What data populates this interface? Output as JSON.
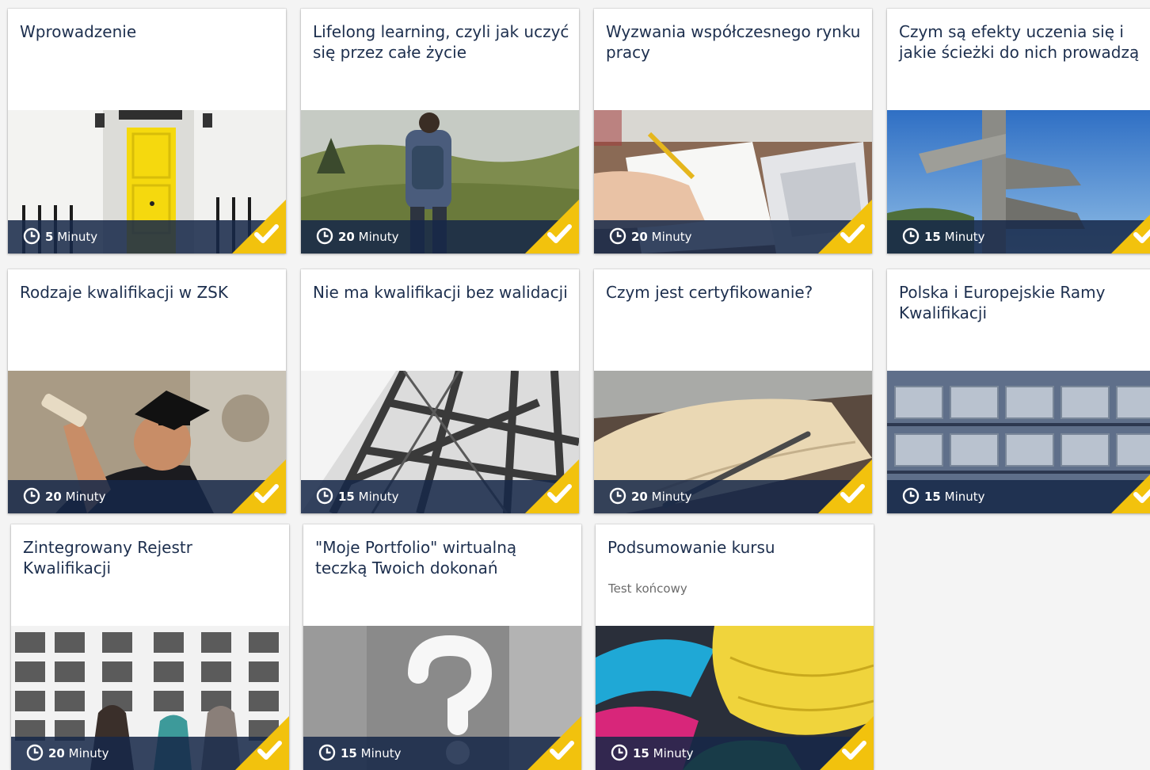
{
  "colors": {
    "title": "#1d2f4e",
    "bar": "#162848",
    "complete_badge": "#f2c20d",
    "subtitle": "#6b6b6b"
  },
  "icons": {
    "duration": "clock-icon",
    "complete": "checkmark-icon"
  },
  "modules": [
    {
      "title": "Wprowadzenie",
      "subtitle": "",
      "duration_value": "5",
      "duration_unit": "Minuty",
      "completed": true,
      "image": "yellow-door"
    },
    {
      "title": "Lifelong learning, czyli jak uczyć się przez całe życie",
      "subtitle": "",
      "duration_value": "20",
      "duration_unit": "Minuty",
      "completed": true,
      "image": "hiker-on-hill"
    },
    {
      "title": "Wyzwania współczesnego rynku pracy",
      "subtitle": "",
      "duration_value": "20",
      "duration_unit": "Minuty",
      "completed": true,
      "image": "writing-at-laptop"
    },
    {
      "title": "Czym są efekty uczenia się i jakie ścieżki do nich prowadzą",
      "subtitle": "",
      "duration_value": "15",
      "duration_unit": "Minuty",
      "completed": true,
      "image": "signpost"
    },
    {
      "title": "Rodzaje kwalifikacji w ZSK",
      "subtitle": "",
      "duration_value": "20",
      "duration_unit": "Minuty",
      "completed": true,
      "image": "graduate"
    },
    {
      "title": "Nie ma kwalifikacji bez walidacji",
      "subtitle": "",
      "duration_value": "15",
      "duration_unit": "Minuty",
      "completed": true,
      "image": "steel-structure"
    },
    {
      "title": "Czym jest certyfikowanie?",
      "subtitle": "",
      "duration_value": "20",
      "duration_unit": "Minuty",
      "completed": true,
      "image": "open-notebook"
    },
    {
      "title": "Polska i Europejskie Ramy Kwalifikacji",
      "subtitle": "",
      "duration_value": "15",
      "duration_unit": "Minuty",
      "completed": true,
      "image": "shelf-boxes"
    },
    {
      "title": "Zintegrowany Rejestr Kwalifikacji",
      "subtitle": "",
      "duration_value": "20",
      "duration_unit": "Minuty",
      "completed": true,
      "image": "photo-wall"
    },
    {
      "title": "\"Moje Portfolio\" wirtualną teczką Twoich dokonań",
      "subtitle": "",
      "duration_value": "15",
      "duration_unit": "Minuty",
      "completed": true,
      "image": "question-mark"
    },
    {
      "title": "Podsumowanie kursu",
      "subtitle": "Test końcowy",
      "duration_value": "15",
      "duration_unit": "Minuty",
      "completed": true,
      "image": "measuring-tape"
    }
  ]
}
